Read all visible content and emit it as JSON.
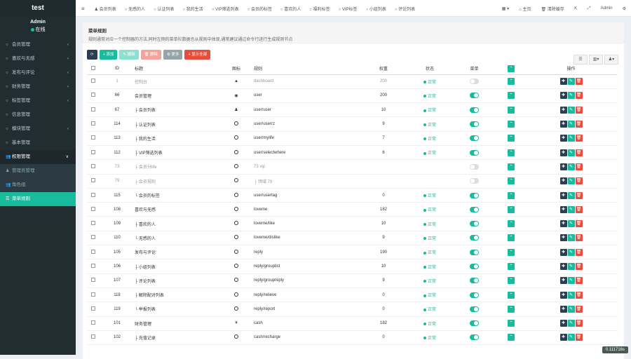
{
  "app": {
    "title": "test"
  },
  "user": {
    "name": "Admin",
    "status": "在线"
  },
  "sidebar": {
    "items": [
      {
        "label": "会员管理",
        "icon": "circle-icon",
        "chev": "‹"
      },
      {
        "label": "喜欢与无感",
        "icon": "circle-icon",
        "chev": "‹"
      },
      {
        "label": "发布与评论",
        "icon": "circle-icon",
        "chev": "‹"
      },
      {
        "label": "财务管理",
        "icon": "circle-icon",
        "chev": "‹"
      },
      {
        "label": "标签管理",
        "icon": "circle-icon",
        "chev": "‹"
      },
      {
        "label": "信息管理",
        "icon": "circle-icon",
        "chev": ""
      },
      {
        "label": "模块管理",
        "icon": "circle-icon",
        "chev": "‹"
      },
      {
        "label": "基本管理",
        "icon": "circle-icon",
        "chev": ""
      },
      {
        "label": "权限管理",
        "icon": "users-icon",
        "chev": "∨"
      }
    ],
    "sub_items": [
      {
        "label": "管理员管理"
      },
      {
        "label": "角色组"
      },
      {
        "label": "菜单规则"
      }
    ]
  },
  "topbar": {
    "tabs": [
      "会员列表",
      "无感的人",
      "认证列表",
      "我的生活",
      "VIP筛选列表",
      "会员的标签",
      "喜欢的人",
      "福利标签",
      "VIP标签",
      "小组列表",
      "评论列表"
    ],
    "right": [
      "▾",
      "主页",
      "清除缓存",
      "",
      "",
      "Admin",
      ""
    ]
  },
  "panel": {
    "title": "菜单规则",
    "desc": "规则通常对应一个控制器的方法,同时左侧的菜单栏数据也从规则中体现,通常建议通过命令行进行生成规则节点"
  },
  "toolbar": {
    "refresh": "⟳",
    "add": "+ 添加",
    "edit": "✎ 编辑",
    "delete": "🗑 删除",
    "more": "⚙ 更多",
    "toggle_all": "+ 显示全部"
  },
  "table": {
    "headers": [
      "ID",
      "标题",
      "图标",
      "规则",
      "权重",
      "状态",
      "菜单",
      "",
      "操作"
    ],
    "rows": [
      {
        "id": "1",
        "title": "控制台",
        "icon": "▲",
        "rule": "dashboard",
        "weight": "200",
        "status": "正常",
        "menu": "off",
        "muted": true
      },
      {
        "id": "66",
        "title": "会员管理",
        "icon": "◉",
        "rule": "user",
        "weight": "200",
        "status": "正常",
        "menu": "on"
      },
      {
        "id": "67",
        "title": "├ 会员列表",
        "icon": "♟",
        "rule": "user/user",
        "weight": "10",
        "status": "正常",
        "menu": "on"
      },
      {
        "id": "114",
        "title": "├ 认证列表",
        "icon": "○",
        "rule": "user/userrz",
        "weight": "9",
        "status": "正常",
        "menu": "on"
      },
      {
        "id": "113",
        "title": "├ 我的生活",
        "icon": "○",
        "rule": "user/mylife",
        "weight": "7",
        "status": "正常",
        "menu": "on"
      },
      {
        "id": "112",
        "title": "├ VIP筛选列表",
        "icon": "○",
        "rule": "user/selectwhere",
        "weight": "6",
        "status": "正常",
        "menu": "on"
      },
      {
        "id": "73",
        "title": "├ 会员分life",
        "icon": "○",
        "rule": "73   vip",
        "weight": "",
        "status": "",
        "menu": "off",
        "muted": true
      },
      {
        "id": "79",
        "title": "├ 会员规则",
        "icon": "○",
        "rule": "├ 领域   79",
        "weight": "",
        "status": "",
        "menu": "off",
        "muted": true
      },
      {
        "id": "115",
        "title": "└ 会员的标签",
        "icon": "○",
        "rule": "user/usertag",
        "weight": "0",
        "status": "正常",
        "menu": "on"
      },
      {
        "id": "108",
        "title": "喜欢与无感",
        "icon": "○",
        "rule": "loveme",
        "weight": "182",
        "status": "正常",
        "menu": "on"
      },
      {
        "id": "109",
        "title": "├ 喜欢的人",
        "icon": "○",
        "rule": "loveme/like",
        "weight": "10",
        "status": "正常",
        "menu": "on"
      },
      {
        "id": "110",
        "title": "└ 无感的人",
        "icon": "○",
        "rule": "loveme/dislike",
        "weight": "9",
        "status": "正常",
        "menu": "on"
      },
      {
        "id": "105",
        "title": "发布与评论",
        "icon": "○",
        "rule": "reply",
        "weight": "190",
        "status": "正常",
        "menu": "on"
      },
      {
        "id": "106",
        "title": "├ 小组列表",
        "icon": "○",
        "rule": "reply/grouplist",
        "weight": "10",
        "status": "正常",
        "menu": "on"
      },
      {
        "id": "107",
        "title": "├ 评论列表",
        "icon": "○",
        "rule": "reply/groupreply",
        "weight": "9",
        "status": "正常",
        "menu": "on"
      },
      {
        "id": "118",
        "title": "├ 解除配对列表",
        "icon": "○",
        "rule": "reply/relieve",
        "weight": "0",
        "status": "正常",
        "menu": "on"
      },
      {
        "id": "119",
        "title": "└ 举报列表",
        "icon": "○",
        "rule": "reply/report",
        "weight": "0",
        "status": "正常",
        "menu": "on"
      },
      {
        "id": "101",
        "title": "财务管理",
        "icon": "¥",
        "rule": "cash",
        "weight": "182",
        "status": "正常",
        "menu": "on"
      },
      {
        "id": "102",
        "title": "├ 充值记录",
        "icon": "○",
        "rule": "cash/recharge",
        "weight": "0",
        "status": "正常",
        "menu": "on"
      }
    ]
  },
  "badge": {
    "text": "0.111716s"
  },
  "colors": {
    "primary": "#18bc9c",
    "dark": "#2c3e50",
    "danger": "#e74c3c",
    "sidebar": "#222d32"
  }
}
